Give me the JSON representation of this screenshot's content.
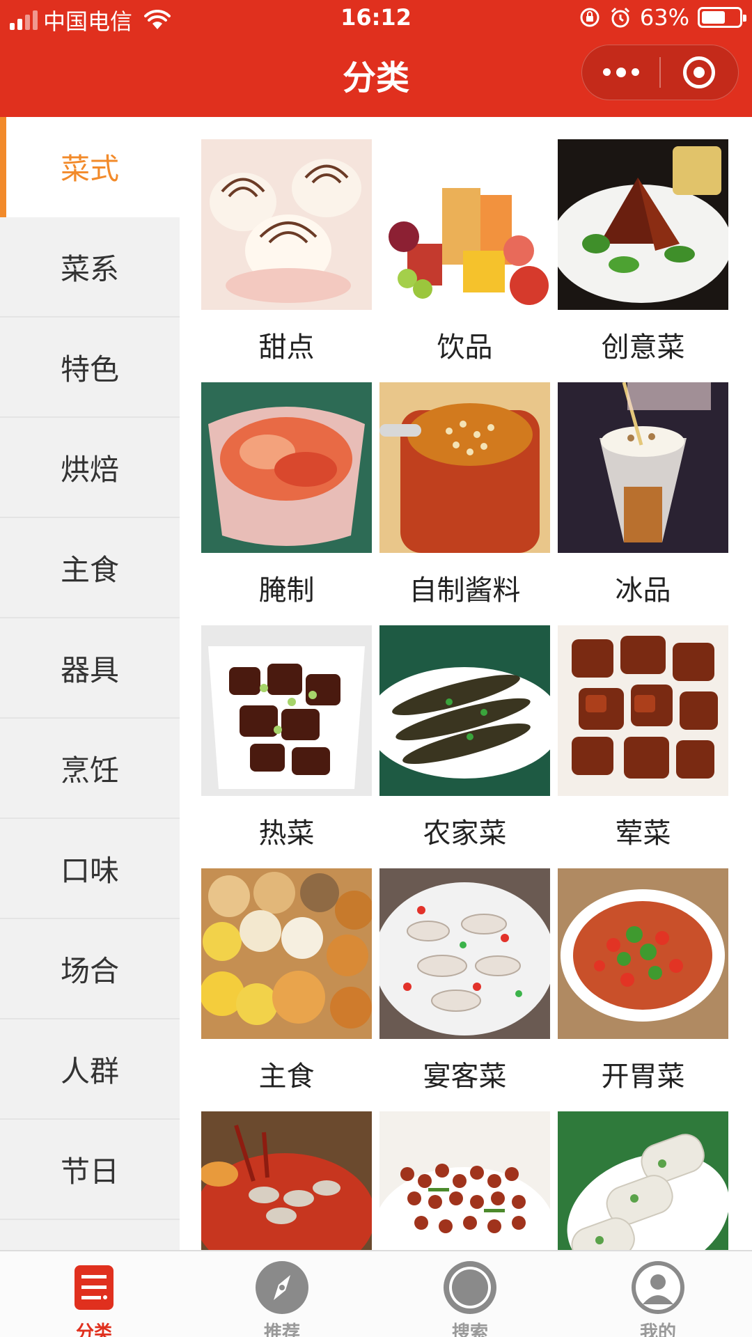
{
  "status_bar": {
    "carrier": "中国电信",
    "time": "16:12",
    "battery": "63%",
    "battery_level": 0.63
  },
  "header": {
    "title": "分类"
  },
  "colors": {
    "brand_red": "#e0301e",
    "active_orange": "#f28a2a"
  },
  "sidebar": {
    "items": [
      {
        "label": "菜式",
        "active": true
      },
      {
        "label": "菜系"
      },
      {
        "label": "特色"
      },
      {
        "label": "烘焙"
      },
      {
        "label": "主食"
      },
      {
        "label": "器具"
      },
      {
        "label": "烹饪"
      },
      {
        "label": "口味"
      },
      {
        "label": "场合"
      },
      {
        "label": "人群"
      },
      {
        "label": "节日"
      }
    ]
  },
  "grid": {
    "items": [
      {
        "label": "甜点"
      },
      {
        "label": "饮品"
      },
      {
        "label": "创意菜"
      },
      {
        "label": "腌制"
      },
      {
        "label": "自制酱料"
      },
      {
        "label": "冰品"
      },
      {
        "label": "热菜"
      },
      {
        "label": "农家菜"
      },
      {
        "label": "荤菜"
      },
      {
        "label": "主食"
      },
      {
        "label": "宴客菜"
      },
      {
        "label": "开胃菜"
      },
      {
        "label": ""
      },
      {
        "label": ""
      },
      {
        "label": ""
      }
    ]
  },
  "tabbar": {
    "tabs": [
      {
        "label": "分类",
        "icon": "category-icon",
        "active": true
      },
      {
        "label": "推荐",
        "icon": "compass-icon"
      },
      {
        "label": "搜索",
        "icon": "search-circle-icon"
      },
      {
        "label": "我的",
        "icon": "user-icon"
      }
    ]
  }
}
